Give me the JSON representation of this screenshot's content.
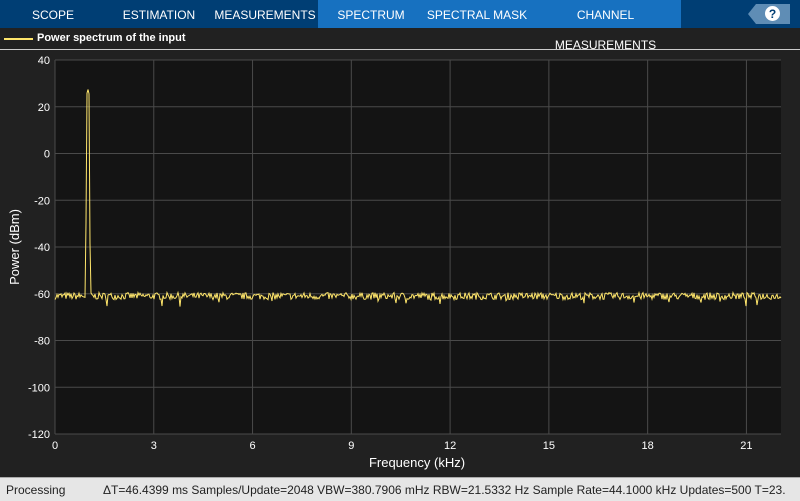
{
  "tabs": [
    {
      "label": "SCOPE"
    },
    {
      "label": "ESTIMATION"
    },
    {
      "label": "MEASUREMENTS"
    },
    {
      "label": "SPECTRUM"
    },
    {
      "label": "SPECTRAL MASK"
    },
    {
      "label": "CHANNEL MEASUREMENTS"
    }
  ],
  "help_label": "?",
  "legend": {
    "label": "Power spectrum of the input",
    "color": "#ffe66b"
  },
  "status": {
    "state": "Processing",
    "info": "ΔT=46.4399 ms  Samples/Update=2048  VBW=380.7906 mHz  RBW=21.5332 Hz  Sample Rate=44.1000 kHz  Updates=500  T=23."
  },
  "chart_data": {
    "type": "line",
    "title": "",
    "xlabel": "Frequency (kHz)",
    "ylabel": "Power (dBm)",
    "xlim": [
      0,
      22.05
    ],
    "ylim": [
      -120,
      40
    ],
    "xticks": [
      0,
      3,
      6,
      9,
      12,
      15,
      18,
      21
    ],
    "yticks": [
      40,
      20,
      0,
      -20,
      -40,
      -60,
      -80,
      -100,
      -120
    ],
    "grid": true,
    "series": [
      {
        "name": "Power spectrum of the input",
        "color": "#ffe66b",
        "peak": {
          "x": 1.0,
          "y": 27.5
        },
        "noise_floor": -61,
        "noise_spread": 1.5
      }
    ]
  }
}
